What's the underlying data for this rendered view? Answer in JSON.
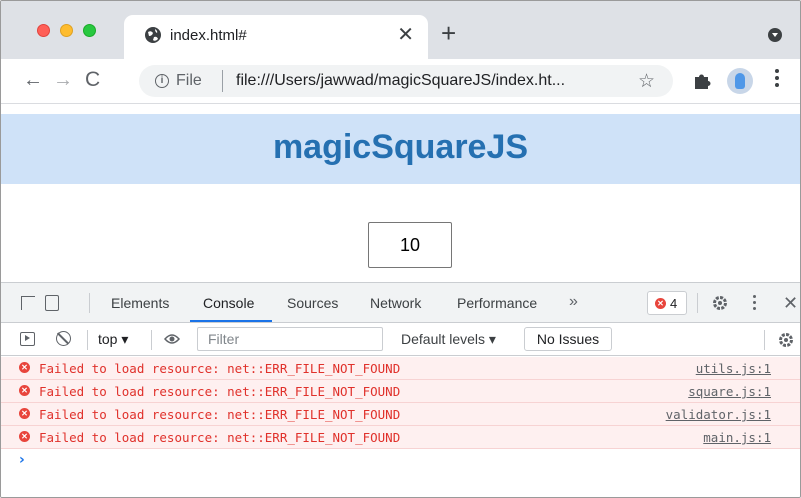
{
  "browser": {
    "tab": {
      "title": "index.html#",
      "close": "✕"
    },
    "new_tab": "+",
    "nav": {
      "back": "←",
      "forward": "→",
      "reload": "C"
    },
    "omnibox": {
      "scheme_label": "File",
      "url": "file:///Users/jawwad/magicSquareJS/index.ht...",
      "star": "☆"
    }
  },
  "page": {
    "title": "magicSquareJS",
    "size_input_value": "10"
  },
  "devtools": {
    "tabs": [
      "Elements",
      "Console",
      "Sources",
      "Network",
      "Performance"
    ],
    "active_tab": "Console",
    "more": "»",
    "error_count": "4",
    "close": "✕",
    "filterbar": {
      "context": "top ▾",
      "filter_placeholder": "Filter",
      "levels": "Default levels ▾",
      "issues": "No Issues"
    },
    "messages": [
      {
        "text": "Failed to load resource: net::ERR_FILE_NOT_FOUND",
        "source": "utils.js:1"
      },
      {
        "text": "Failed to load resource: net::ERR_FILE_NOT_FOUND",
        "source": "square.js:1"
      },
      {
        "text": "Failed to load resource: net::ERR_FILE_NOT_FOUND",
        "source": "validator.js:1"
      },
      {
        "text": "Failed to load resource: net::ERR_FILE_NOT_FOUND",
        "source": "main.js:1"
      }
    ],
    "prompt": "›"
  },
  "colors": {
    "header_bg": "#cfe2f8",
    "title_color": "#2570b1",
    "error_red": "#e0312b",
    "error_row_bg": "#fef0f0",
    "devtools_accent": "#1a73e8"
  },
  "icons": [
    "globe-icon",
    "info-icon",
    "star-icon",
    "puzzle-icon",
    "profile-icon",
    "menu-icon",
    "inspect-icon",
    "device-icon",
    "gear-icon",
    "sidebar-icon",
    "clear-icon",
    "eye-icon",
    "error-icon"
  ]
}
